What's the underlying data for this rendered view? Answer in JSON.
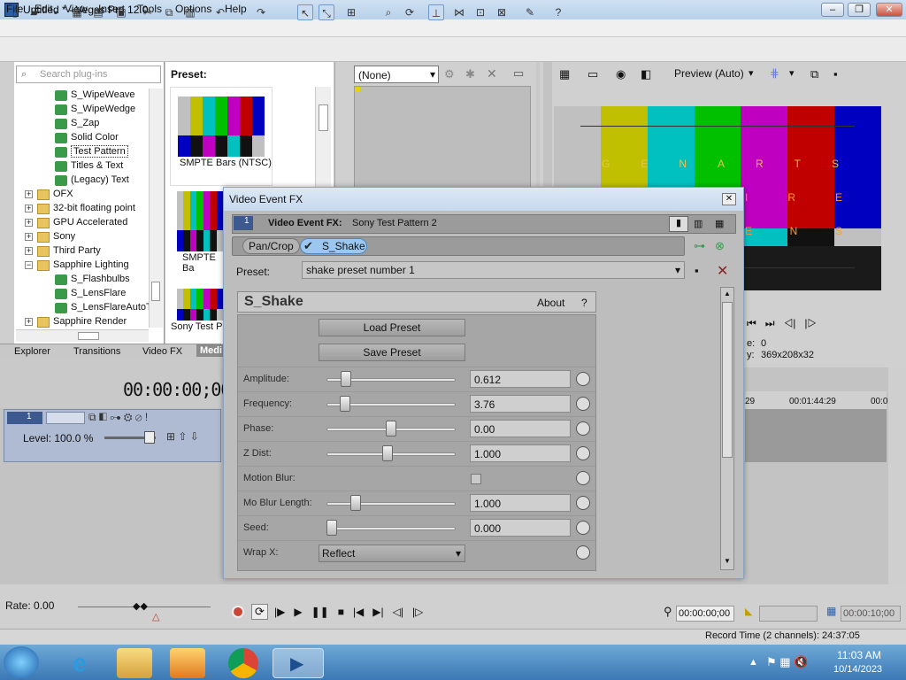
{
  "window": {
    "title": "Untitled * - Vegas Pro 12.0"
  },
  "menus": [
    "File",
    "Edit",
    "View",
    "Insert",
    "Tools",
    "Options",
    "Help"
  ],
  "explorer": {
    "search_placeholder": "Search plug-ins",
    "tree": [
      {
        "label": "S_WipeWeave",
        "type": "fx",
        "indent": 66
      },
      {
        "label": "S_WipeWedge",
        "type": "fx",
        "indent": 66
      },
      {
        "label": "S_Zap",
        "type": "fx",
        "indent": 66
      },
      {
        "label": "Solid Color",
        "type": "fx",
        "indent": 66
      },
      {
        "label": "Test Pattern",
        "type": "fx",
        "indent": 66,
        "selected": true
      },
      {
        "label": "Titles & Text",
        "type": "fx",
        "indent": 66
      },
      {
        "label": "(Legacy) Text",
        "type": "fx",
        "indent": 66
      },
      {
        "label": "OFX",
        "type": "folder",
        "indent": 46,
        "expander": "+"
      },
      {
        "label": "32-bit floating point",
        "type": "folder",
        "indent": 46,
        "expander": "+"
      },
      {
        "label": "GPU Accelerated",
        "type": "folder",
        "indent": 46,
        "expander": "+"
      },
      {
        "label": "Sony",
        "type": "folder",
        "indent": 46,
        "expander": "+"
      },
      {
        "label": "Third Party",
        "type": "folder",
        "indent": 46,
        "expander": "+"
      },
      {
        "label": "Sapphire Lighting",
        "type": "folder",
        "indent": 46,
        "expander": "−"
      },
      {
        "label": "S_Flashbulbs",
        "type": "fx",
        "indent": 66
      },
      {
        "label": "S_LensFlare",
        "type": "fx",
        "indent": 66
      },
      {
        "label": "S_LensFlareAutoT",
        "type": "fx",
        "indent": 66
      },
      {
        "label": "Sapphire Render",
        "type": "folder",
        "indent": 46,
        "expander": "+"
      }
    ],
    "tabs": [
      "Explorer",
      "Transitions",
      "Video FX",
      "Medi"
    ]
  },
  "presets": {
    "header": "Preset:",
    "items": [
      "SMPTE Bars (NTSC)",
      "SMPTE Ba",
      "Sony Test Pa"
    ]
  },
  "video_pane": {
    "dropdown": "(None)"
  },
  "preview": {
    "label": "Preview (Auto)",
    "overlay_letters_row1": [
      "G",
      "E",
      "N",
      "A",
      "R",
      "T",
      "S"
    ],
    "overlay_letters_row2": [
      "I",
      "R",
      "E"
    ],
    "overlay_letters_row3": [
      "E",
      "N",
      "S"
    ],
    "info_frame_label": "e:",
    "info_frame_value": "0",
    "info_display_label": "y:",
    "info_display_value": "369x208x32"
  },
  "timeline": {
    "timecode": "00:00:00;00",
    "level": "Level: 100.0 %",
    "ruler": [
      "29",
      "00:01:44:29",
      "00:0"
    ],
    "rate": "Rate: 0.00"
  },
  "transport": {
    "time1": "00:00:00;00",
    "time2": "00:00:10;00"
  },
  "status": {
    "record_time": "Record Time (2 channels): 24:37:05"
  },
  "dialog": {
    "title": "Video Event FX",
    "fx_label": "Video Event FX:",
    "fx_name": "Sony Test Pattern 2",
    "chain": [
      "Pan/Crop",
      "S_Shake"
    ],
    "preset_label": "Preset:",
    "preset_value": "shake preset number 1",
    "plugin_name": "S_Shake",
    "about": "About",
    "help": "?",
    "load_preset": "Load Preset",
    "save_preset": "Save Preset",
    "params": [
      {
        "name": "Amplitude:",
        "value": "0.612",
        "pos": 0.12
      },
      {
        "name": "Frequency:",
        "value": "3.76",
        "pos": 0.11
      },
      {
        "name": "Phase:",
        "value": "0.00",
        "pos": 0.5
      },
      {
        "name": "Z Dist:",
        "value": "1.000",
        "pos": 0.47
      },
      {
        "name": "Motion Blur:",
        "value": "",
        "checkbox": true
      },
      {
        "name": "Mo Blur Length:",
        "value": "1.000",
        "pos": 0.2
      },
      {
        "name": "Seed:",
        "value": "0.000",
        "pos": 0.0
      },
      {
        "name": "Wrap X:",
        "value": "Reflect",
        "select": true
      }
    ]
  },
  "clock": {
    "time": "11:03 AM",
    "date": "10/14/2023"
  }
}
